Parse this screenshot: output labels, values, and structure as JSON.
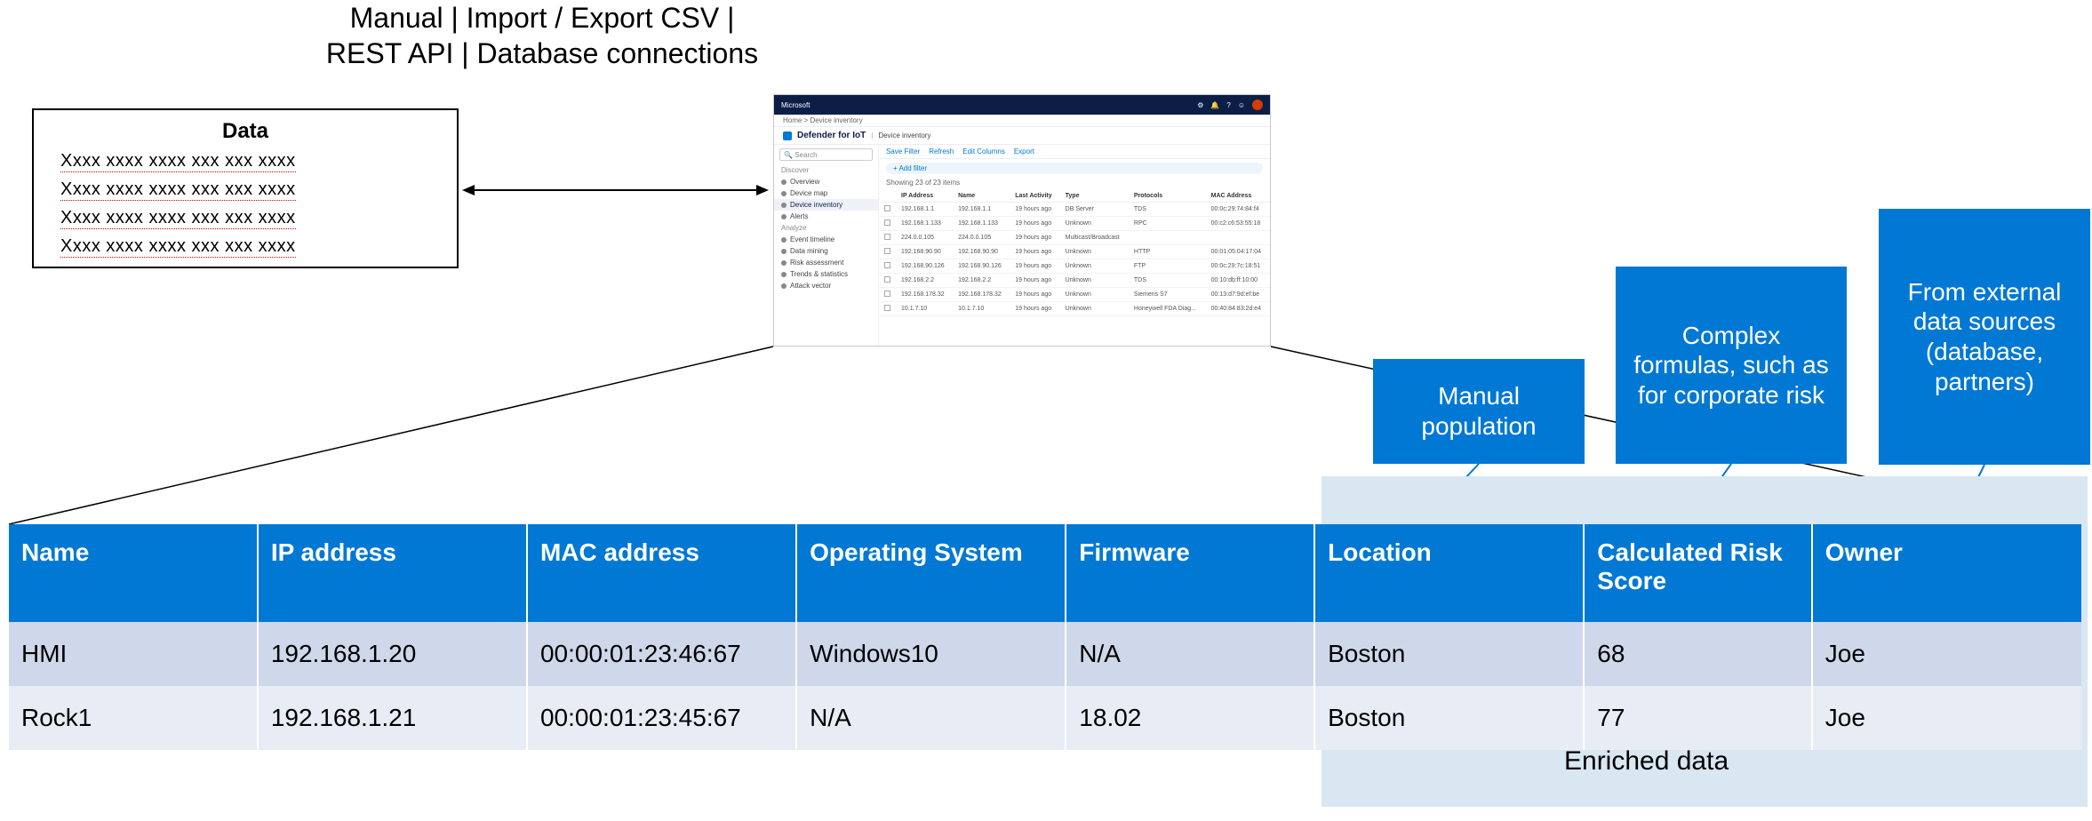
{
  "top_caption_line1": "Manual | Import / Export CSV |",
  "top_caption_line2": "REST API | Database connections",
  "data_box": {
    "heading": "Data",
    "line": "Xxxx xxxx xxxx xxx xxx xxxx"
  },
  "app": {
    "brand": "Microsoft",
    "breadcrumb": "Home  >  Device inventory",
    "product": "Defender for IoT",
    "page_title": "Device inventory",
    "search_placeholder": "Search",
    "side": {
      "discover_label": "Discover",
      "items_discover": [
        "Overview",
        "Device map",
        "Device inventory",
        "Alerts"
      ],
      "analyze_label": "Analyze",
      "items_analyze": [
        "Event timeline",
        "Data mining",
        "Risk assessment",
        "Trends & statistics",
        "Attack vector"
      ]
    },
    "toolbar": {
      "save_filter": "Save Filter",
      "refresh": "Refresh",
      "edit_cols": "Edit Columns",
      "export": "Export"
    },
    "add_filter": "+ Add filter",
    "showing": "Showing 23 of 23 items",
    "columns": [
      "IP Address",
      "Name",
      "Last Activity",
      "Type",
      "Protocols",
      "MAC Address"
    ],
    "rows": [
      [
        "192.168.1.1",
        "192.168.1.1",
        "19 hours ago",
        "DB Server",
        "TDS",
        "00:0c:29:74:84:f4"
      ],
      [
        "192.168.1.133",
        "192.168.1.133",
        "19 hours ago",
        "Unknown",
        "RPC",
        "00:c2:c6:53:55:18"
      ],
      [
        "224.0.0.105",
        "224.0.0.105",
        "19 hours ago",
        "Multicast/Broadcast",
        "",
        ""
      ],
      [
        "192.168.90.90",
        "192.168.90.90",
        "19 hours ago",
        "Unknown",
        "HTTP",
        "00:01:05:04:17:04"
      ],
      [
        "192.168.90.126",
        "192.168.90.126",
        "19 hours ago",
        "Unknown",
        "FTP",
        "00:0c:29:7c:18:51"
      ],
      [
        "192.168.2.2",
        "192.168.2.2",
        "19 hours ago",
        "Unknown",
        "TDS",
        "00:10:db:ff:10:00"
      ],
      [
        "192.168.178.32",
        "192.168.178.32",
        "19 hours ago",
        "Unknown",
        "Siemens S7",
        "00:13:d7:9d:ef:be"
      ],
      [
        "10.1.7.10",
        "10.1.7.10",
        "19 hours ago",
        "Unknown",
        "Honeywell FDA Diag...",
        "00:40:84:83:2d:e4"
      ]
    ]
  },
  "callouts": {
    "c1": "Manual population",
    "c2": "Complex formulas, such as for corporate risk",
    "c3": "From external data sources (database, partners)"
  },
  "enriched_label": "Enriched data",
  "table": {
    "headers": {
      "name": "Name",
      "ip": "IP address",
      "mac": "MAC address",
      "os": "Operating System",
      "fw": "Firmware",
      "loc": "Location",
      "risk": "Calculated Risk Score",
      "own": "Owner"
    },
    "rows": [
      {
        "name": "HMI",
        "ip": "192.168.1.20",
        "mac": "00:00:01:23:46:67",
        "os": "Windows10",
        "fw": "N/A",
        "loc": "Boston",
        "risk": "68",
        "own": "Joe"
      },
      {
        "name": "Rock1",
        "ip": "192.168.1.21",
        "mac": "00:00:01:23:45:67",
        "os": "N/A",
        "fw": "18.02",
        "loc": "Boston",
        "risk": "77",
        "own": "Joe"
      }
    ]
  }
}
